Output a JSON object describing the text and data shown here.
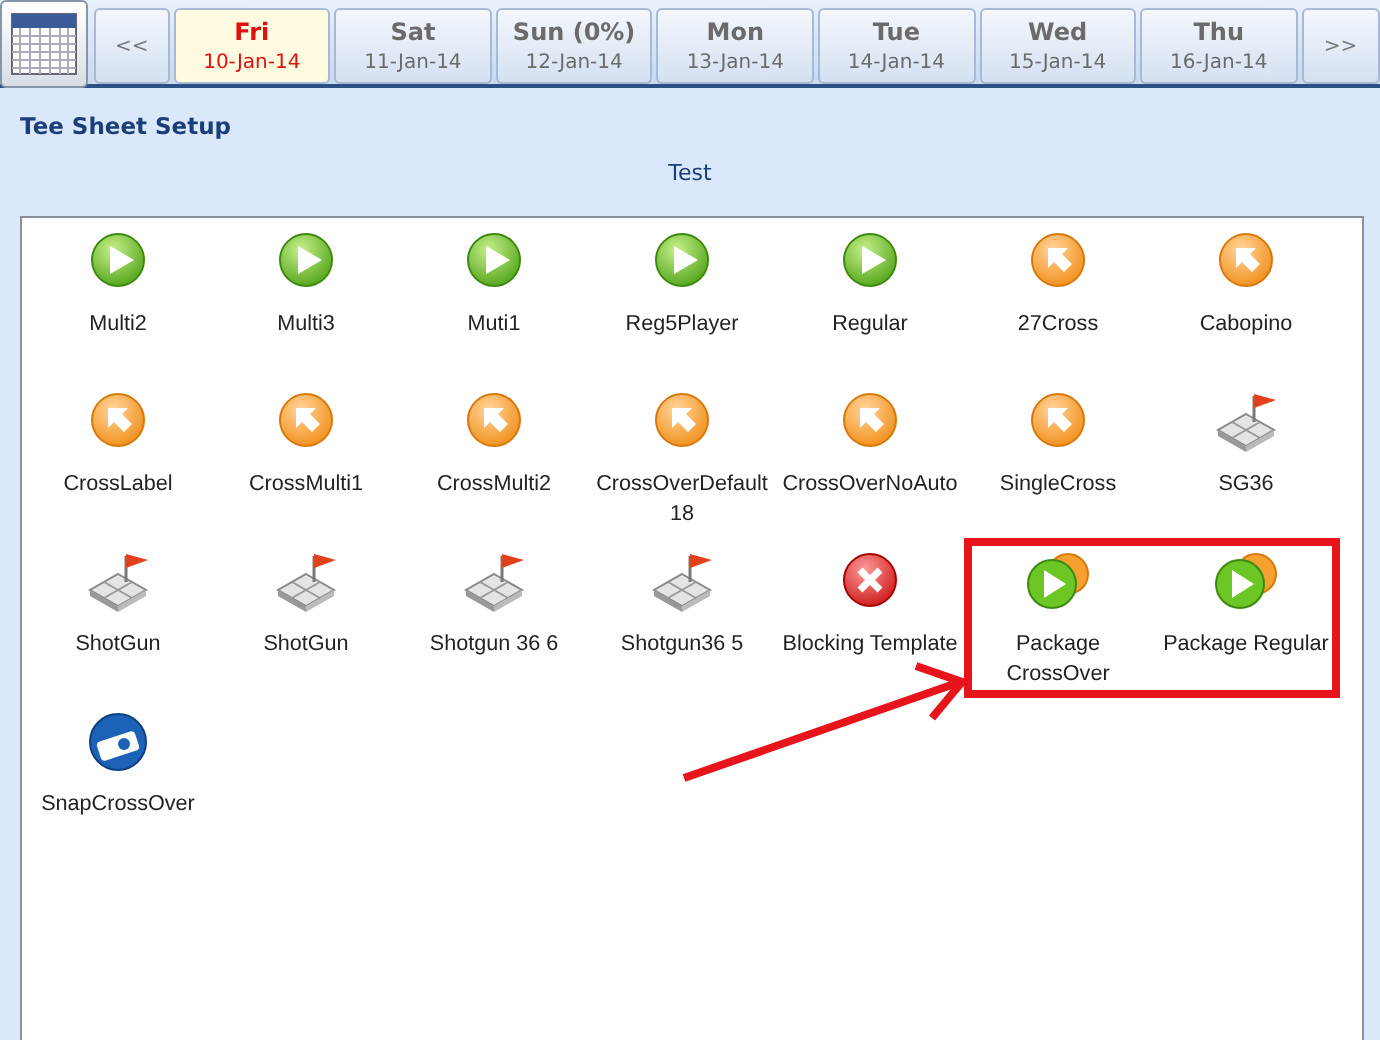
{
  "nav": {
    "prev": "<<",
    "next": ">>"
  },
  "days": [
    {
      "day": "Fri",
      "date": "10-Jan-14",
      "selected": true
    },
    {
      "day": "Sat",
      "date": "11-Jan-14",
      "selected": false
    },
    {
      "day": "Sun (0%)",
      "date": "12-Jan-14",
      "selected": false
    },
    {
      "day": "Mon",
      "date": "13-Jan-14",
      "selected": false
    },
    {
      "day": "Tue",
      "date": "14-Jan-14",
      "selected": false
    },
    {
      "day": "Wed",
      "date": "15-Jan-14",
      "selected": false
    },
    {
      "day": "Thu",
      "date": "16-Jan-14",
      "selected": false
    }
  ],
  "page_title": "Tee Sheet Setup",
  "group_title": "Test",
  "templates": [
    {
      "label": "Multi2",
      "kind": "regular",
      "highlighted": false
    },
    {
      "label": "Multi3",
      "kind": "regular",
      "highlighted": false
    },
    {
      "label": "Muti1",
      "kind": "regular",
      "highlighted": false
    },
    {
      "label": "Reg5Player",
      "kind": "regular",
      "highlighted": false
    },
    {
      "label": "Regular",
      "kind": "regular",
      "highlighted": false
    },
    {
      "label": "27Cross",
      "kind": "cross",
      "highlighted": false
    },
    {
      "label": "Cabopino",
      "kind": "cross",
      "highlighted": false
    },
    {
      "label": "CrossLabel",
      "kind": "cross",
      "highlighted": false
    },
    {
      "label": "CrossMulti1",
      "kind": "cross",
      "highlighted": false
    },
    {
      "label": "CrossMulti2",
      "kind": "cross",
      "highlighted": false
    },
    {
      "label": "CrossOverDefault 18",
      "kind": "cross",
      "highlighted": false
    },
    {
      "label": "CrossOverNoAuto",
      "kind": "cross",
      "highlighted": false
    },
    {
      "label": "SingleCross",
      "kind": "cross",
      "highlighted": false
    },
    {
      "label": "SG36",
      "kind": "shotgun",
      "highlighted": false
    },
    {
      "label": "ShotGun",
      "kind": "shotgun",
      "highlighted": false
    },
    {
      "label": "ShotGun",
      "kind": "shotgun",
      "highlighted": false
    },
    {
      "label": "Shotgun 36 6",
      "kind": "shotgun",
      "highlighted": false
    },
    {
      "label": "Shotgun36 5",
      "kind": "shotgun",
      "highlighted": false
    },
    {
      "label": "Blocking Template",
      "kind": "blocking",
      "highlighted": false
    },
    {
      "label": "Package CrossOver",
      "kind": "package",
      "highlighted": true
    },
    {
      "label": "Package Regular",
      "kind": "package",
      "highlighted": true
    },
    {
      "label": "SnapCrossOver",
      "kind": "snap",
      "highlighted": false
    }
  ]
}
